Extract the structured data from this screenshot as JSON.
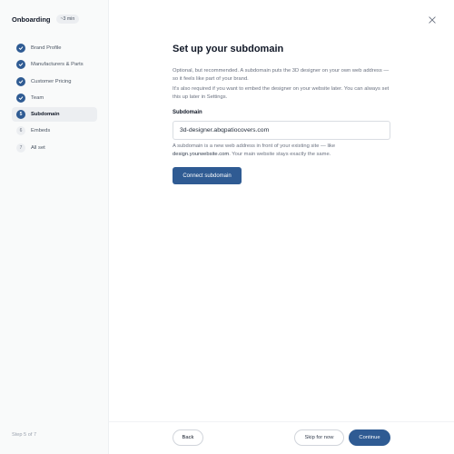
{
  "sidebar": {
    "title": "Onboarding",
    "time_badge": "~3 min",
    "steps": [
      {
        "number": "1",
        "label": "Brand Profile",
        "status": "done"
      },
      {
        "number": "2",
        "label": "Manufacturers & Parts",
        "status": "done"
      },
      {
        "number": "3",
        "label": "Customer Pricing",
        "status": "done"
      },
      {
        "number": "4",
        "label": "Team",
        "status": "done"
      },
      {
        "number": "5",
        "label": "Subdomain",
        "status": "current"
      },
      {
        "number": "6",
        "label": "Embeds",
        "status": "todo"
      },
      {
        "number": "7",
        "label": "All set",
        "status": "todo"
      }
    ],
    "step_footer": "Step 5 of 7"
  },
  "main": {
    "title": "Set up your subdomain",
    "description1": "Optional, but recommended. A subdomain puts the 3D designer on your own web address — so it feels like part of your brand.",
    "description2": "It's also required if you want to embed the designer on your website later. You can always set this up later in Settings.",
    "field_label": "Subdomain",
    "field_value": "3d-designer.abqpatiocovers.com",
    "hint_pre": "A subdomain is a new web address in front of your existing site — like",
    "hint_example": "design.yourwebsite.com",
    "hint_post": ". Your main website stays exactly the same.",
    "connect_button": "Connect subdomain"
  },
  "footer": {
    "back": "Back",
    "skip": "Skip for now",
    "continue": "Continue"
  },
  "icons": {
    "close": "close-icon",
    "check": "check-icon"
  },
  "colors": {
    "accent": "#2f5b93",
    "sidebar_bg": "#f9fafa",
    "active_bg": "#eceef1"
  }
}
